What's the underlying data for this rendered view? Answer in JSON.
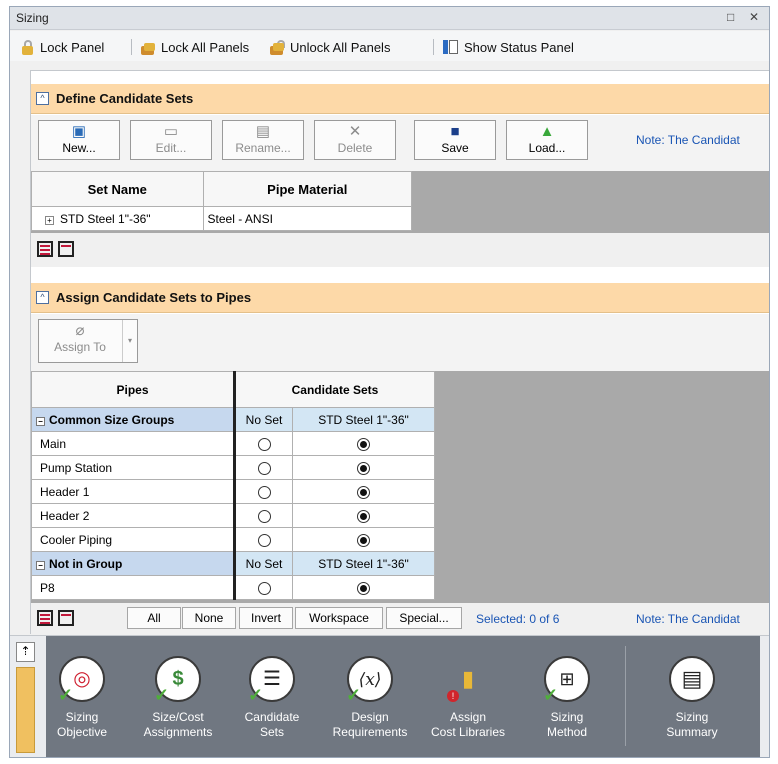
{
  "window": {
    "title": "Sizing"
  },
  "toolbar": {
    "lock_panel": "Lock Panel",
    "lock_all": "Lock All Panels",
    "unlock_all": "Unlock All Panels",
    "show_status": "Show Status Panel"
  },
  "define": {
    "header": "Define Candidate Sets",
    "buttons": {
      "new": "New...",
      "edit": "Edit...",
      "rename": "Rename...",
      "delete": "Delete",
      "save": "Save",
      "load": "Load..."
    },
    "note": "Note: The Candidat",
    "columns": [
      "Set Name",
      "Pipe Material"
    ],
    "rows": [
      {
        "name": "STD Steel 1\"-36\"",
        "material": "Steel - ANSI"
      }
    ]
  },
  "assign": {
    "header": "Assign Candidate Sets to Pipes",
    "assign_to": "Assign To",
    "columns": [
      "Pipes",
      "Candidate Sets"
    ],
    "groups": [
      {
        "title": "Common Size Groups",
        "no_set": "No Set",
        "set": "STD Steel 1\"-36\"",
        "rows": [
          "Main",
          "Pump Station",
          "Header 1",
          "Header 2",
          "Cooler Piping"
        ]
      },
      {
        "title": "Not in Group",
        "no_set": "No Set",
        "set": "STD Steel 1\"-36\"",
        "rows": [
          "P8"
        ]
      }
    ],
    "buttons": {
      "all": "All",
      "none": "None",
      "invert": "Invert",
      "workspace": "Workspace",
      "special": "Special..."
    },
    "selected": "Selected: 0 of 6",
    "note": "Note: The Candidat"
  },
  "nav": [
    {
      "label1": "Sizing",
      "label2": "Objective",
      "icon": "target-icon"
    },
    {
      "label1": "Size/Cost",
      "label2": "Assignments",
      "icon": "ruler-dollar-icon"
    },
    {
      "label1": "Candidate",
      "label2": "Sets",
      "icon": "list-icon"
    },
    {
      "label1": "Design",
      "label2": "Requirements",
      "icon": "function-icon"
    },
    {
      "label1": "Assign",
      "label2": "Cost Libraries",
      "icon": "database-dollar-icon"
    },
    {
      "label1": "Sizing",
      "label2": "Method",
      "icon": "flowchart-icon"
    },
    {
      "label1": "Sizing",
      "label2": "Summary",
      "icon": "document-icon"
    }
  ]
}
